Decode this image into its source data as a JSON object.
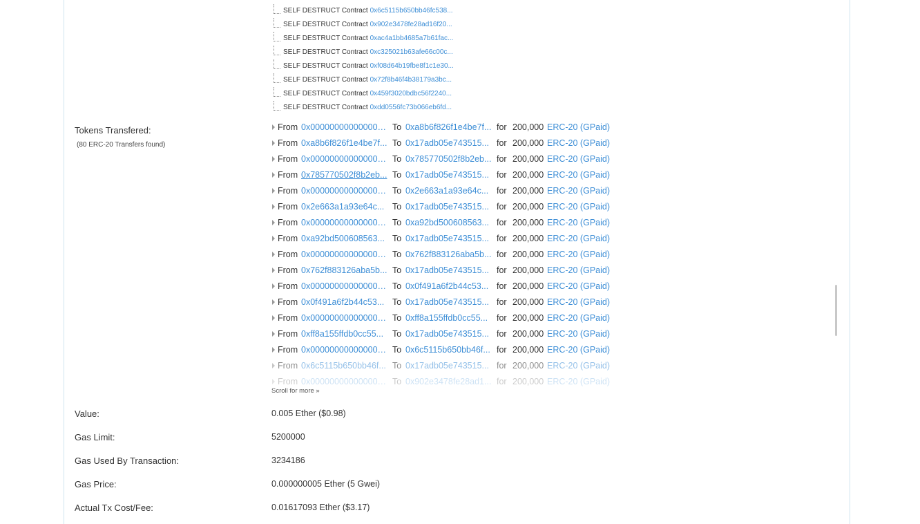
{
  "self_destructs": [
    {
      "label": "SELF DESTRUCT Contract",
      "address": "0x6c5115b650bb46fc538..."
    },
    {
      "label": "SELF DESTRUCT Contract",
      "address": "0x902e3478fe28ad16f20..."
    },
    {
      "label": "SELF DESTRUCT Contract",
      "address": "0xac4a1bb4685a7b61fac..."
    },
    {
      "label": "SELF DESTRUCT Contract",
      "address": "0xc325021b63afe66c00c..."
    },
    {
      "label": "SELF DESTRUCT Contract",
      "address": "0xf08d64b19fbe8f1c1e30..."
    },
    {
      "label": "SELF DESTRUCT Contract",
      "address": "0x72f8b46f4b38179a3bc..."
    },
    {
      "label": "SELF DESTRUCT Contract",
      "address": "0x459f3020bdbc56f2240..."
    },
    {
      "label": "SELF DESTRUCT Contract",
      "address": "0xdd0556fc73b066eb6fd..."
    }
  ],
  "tokens": {
    "label": "Tokens Transfered:",
    "sublabel": "(80 ERC-20 Transfers found)",
    "from_word": "From",
    "to_word": "To",
    "for_word": "for",
    "scroll_more": "Scroll for more »",
    "transfers": [
      {
        "from": "0x0000000000000000000000000000000000000000",
        "to": "0xa8b6f826f1e4be7f...",
        "amount": "200,000",
        "token": "ERC-20 (GPaid)"
      },
      {
        "from": "0xa8b6f826f1e4be7f...",
        "to": "0x17adb05e743515...",
        "amount": "200,000",
        "token": "ERC-20 (GPaid)"
      },
      {
        "from": "0x0000000000000000000000000000000000000000",
        "to": "0x785770502f8b2eb...",
        "amount": "200,000",
        "token": "ERC-20 (GPaid)"
      },
      {
        "from": "0x785770502f8b2eb...",
        "to": "0x17adb05e743515...",
        "amount": "200,000",
        "token": "ERC-20 (GPaid)"
      },
      {
        "from": "0x0000000000000000000000000000000000000000",
        "to": "0x2e663a1a93e64c...",
        "amount": "200,000",
        "token": "ERC-20 (GPaid)"
      },
      {
        "from": "0x2e663a1a93e64c...",
        "to": "0x17adb05e743515...",
        "amount": "200,000",
        "token": "ERC-20 (GPaid)"
      },
      {
        "from": "0x0000000000000000000000000000000000000000",
        "to": "0xa92bd500608563...",
        "amount": "200,000",
        "token": "ERC-20 (GPaid)"
      },
      {
        "from": "0xa92bd500608563...",
        "to": "0x17adb05e743515...",
        "amount": "200,000",
        "token": "ERC-20 (GPaid)"
      },
      {
        "from": "0x0000000000000000000000000000000000000000",
        "to": "0x762f883126aba5b...",
        "amount": "200,000",
        "token": "ERC-20 (GPaid)"
      },
      {
        "from": "0x762f883126aba5b...",
        "to": "0x17adb05e743515...",
        "amount": "200,000",
        "token": "ERC-20 (GPaid)"
      },
      {
        "from": "0x0000000000000000000000000000000000000000",
        "to": "0x0f491a6f2b44c53...",
        "amount": "200,000",
        "token": "ERC-20 (GPaid)"
      },
      {
        "from": "0x0f491a6f2b44c53...",
        "to": "0x17adb05e743515...",
        "amount": "200,000",
        "token": "ERC-20 (GPaid)"
      },
      {
        "from": "0x0000000000000000000000000000000000000000",
        "to": "0xff8a155ffdb0cc55...",
        "amount": "200,000",
        "token": "ERC-20 (GPaid)"
      },
      {
        "from": "0xff8a155ffdb0cc55...",
        "to": "0x17adb05e743515...",
        "amount": "200,000",
        "token": "ERC-20 (GPaid)"
      },
      {
        "from": "0x0000000000000000000000000000000000000000",
        "to": "0x6c5115b650bb46f...",
        "amount": "200,000",
        "token": "ERC-20 (GPaid)"
      },
      {
        "from": "0x6c5115b650bb46f...",
        "to": "0x17adb05e743515...",
        "amount": "200,000",
        "token": "ERC-20 (GPaid)"
      },
      {
        "from": "0x0000000000000000000000000000000000000000",
        "to": "0x902e3478fe28ad1...",
        "amount": "200,000",
        "token": "ERC-20 (GPaid)"
      }
    ]
  },
  "details": [
    {
      "label": "Value:",
      "value": "0.005 Ether ($0.98)"
    },
    {
      "label": "Gas Limit:",
      "value": "5200000"
    },
    {
      "label": "Gas Used By Transaction:",
      "value": "3234186"
    },
    {
      "label": "Gas Price:",
      "value": "0.000000005 Ether (5 Gwei)"
    },
    {
      "label": "Actual Tx Cost/Fee:",
      "value": "0.01617093 Ether ($3.17)"
    }
  ],
  "colors": {
    "link": "#3d8ed6",
    "text": "#333333",
    "border": "#cfe3ee"
  }
}
